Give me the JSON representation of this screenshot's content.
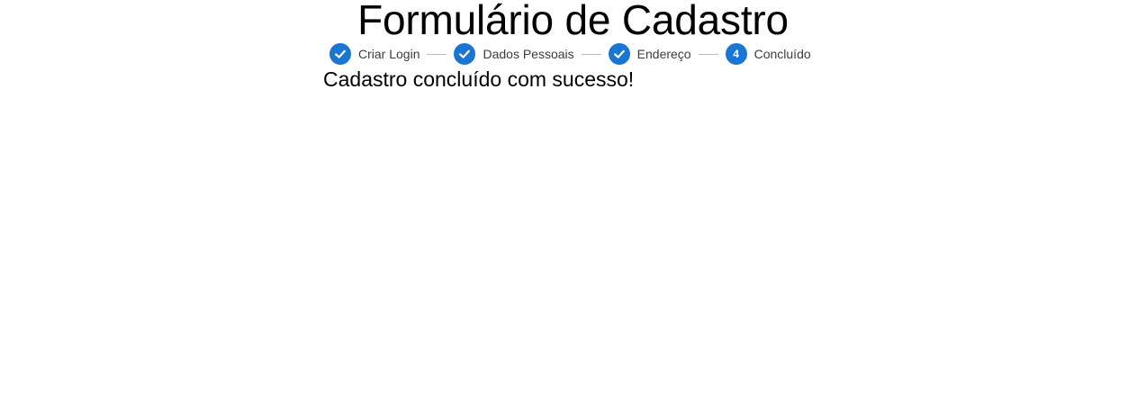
{
  "page": {
    "title": "Formulário de Cadastro"
  },
  "stepper": {
    "steps": [
      {
        "label": "Criar Login",
        "state": "completed",
        "icon": "check-icon"
      },
      {
        "label": "Dados Pessoais",
        "state": "completed",
        "icon": "check-icon"
      },
      {
        "label": "Endereço",
        "state": "completed",
        "icon": "check-icon"
      },
      {
        "label": "Concluído",
        "state": "active",
        "number": "4"
      }
    ],
    "accent_color": "#1976d2",
    "connector_color": "#bdbdbd"
  },
  "content": {
    "message": "Cadastro concluído com sucesso!"
  }
}
